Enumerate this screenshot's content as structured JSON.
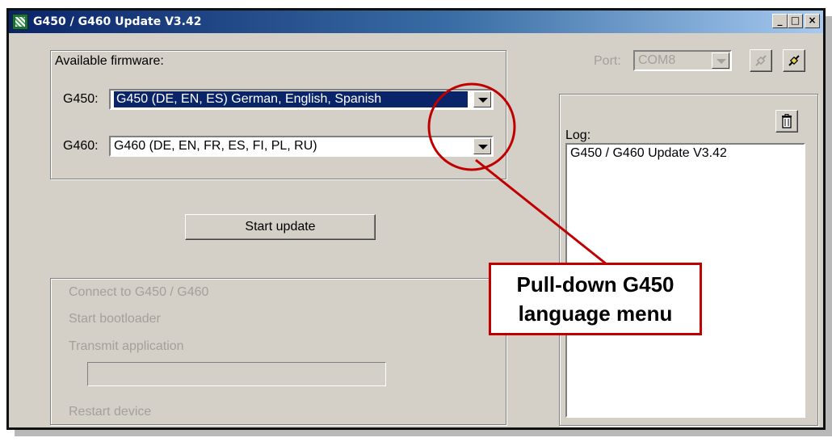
{
  "window": {
    "title": "G450 / G460 Update V3.42",
    "minimize": "_",
    "maximize": "□",
    "close": "×"
  },
  "firmware": {
    "group_label": "Available firmware:",
    "g450_label": "G450:",
    "g450_value": "G450 (DE, EN, ES)   German, English, Spanish",
    "g460_label": "G460:",
    "g460_value": "G460 (DE, EN, FR, ES, FI, PL, RU)"
  },
  "actions": {
    "start_update": "Start update"
  },
  "steps": {
    "connect": "Connect to G450 / G460",
    "bootloader": "Start bootloader",
    "transmit": "Transmit application",
    "restart": "Restart device",
    "progress": 0
  },
  "port": {
    "label": "Port:",
    "value": "COM8"
  },
  "log": {
    "label": "Log:",
    "lines": [
      "G450 / G460 Update V3.42"
    ]
  },
  "annotation": {
    "line1": "Pull-down G450",
    "line2": "language menu",
    "color": "#c00000"
  },
  "icons": {
    "port_disconnect": "disconnect-plug-icon",
    "port_connect": "connect-plug-icon",
    "log_clear": "trash-icon"
  }
}
